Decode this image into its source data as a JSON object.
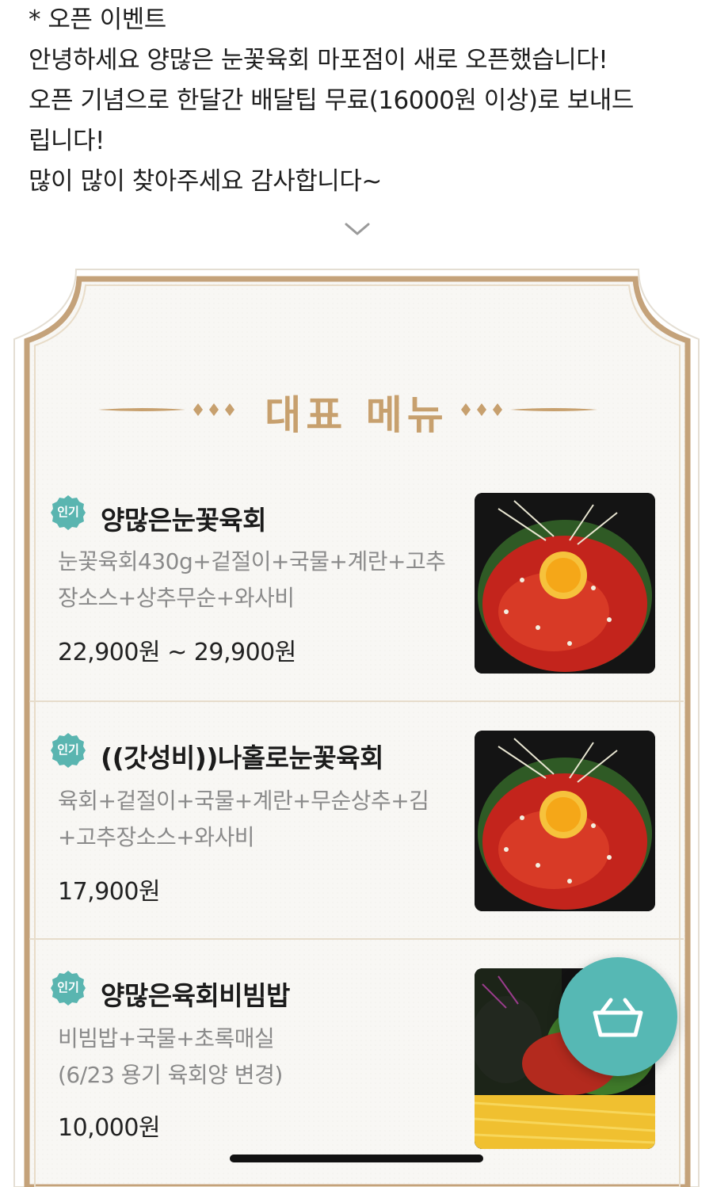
{
  "notice": {
    "lines": [
      "* 오픈 이벤트",
      "안녕하세요 양많은 눈꽃육회 마포점이 새로 오픈했습니다!",
      "오픈 기념으로 한달간 배달팁 무료(16000원 이상)로 보내드",
      "립니다!",
      "많이 많이 찾아주세요 감사합니다~"
    ]
  },
  "section": {
    "title": "대표 메뉴"
  },
  "menu_items": [
    {
      "badge": "인기",
      "name": "양많은눈꽃육회",
      "desc_lines": [
        "눈꽃육회430g+겉절이+국물+계란+고추",
        "장소스+상추무순+와사비"
      ],
      "price": "22,900원 ~ 29,900원"
    },
    {
      "badge": "인기",
      "name": "((갓성비))나홀로눈꽃육회",
      "desc_lines": [
        "육회+겉절이+국물+계란+무순상추+김",
        "+고추장소스+와사비"
      ],
      "price": "17,900원"
    },
    {
      "badge": "인기",
      "name": "양많은육회비빔밥",
      "desc_lines": [
        "비빔밥+국물+초록매실",
        "(6/23 용기 육회양 변경)"
      ],
      "price": "10,000원"
    }
  ],
  "icons": {
    "expand": "chevron-down-icon",
    "cart": "basket-icon"
  },
  "colors": {
    "accent_gold": "#c7a06e",
    "badge_teal": "#5ab5b0",
    "cart_teal": "#56b8b4"
  }
}
